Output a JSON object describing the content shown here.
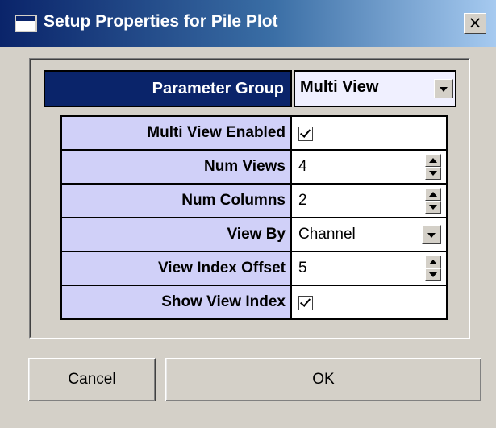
{
  "window": {
    "title": "Setup Properties for Pile Plot",
    "close_label": "×"
  },
  "parameter_group": {
    "label": "Parameter Group",
    "value": "Multi View"
  },
  "properties": [
    {
      "label": "Multi View Enabled",
      "type": "checkbox",
      "checked": true
    },
    {
      "label": "Num Views",
      "type": "spinner",
      "value": "4"
    },
    {
      "label": "Num Columns",
      "type": "spinner",
      "value": "2"
    },
    {
      "label": "View By",
      "type": "dropdown",
      "value": "Channel"
    },
    {
      "label": "View Index Offset",
      "type": "spinner",
      "value": "5"
    },
    {
      "label": "Show View Index",
      "type": "checkbox",
      "checked": true
    }
  ],
  "buttons": {
    "cancel": "Cancel",
    "ok": "OK"
  },
  "colors": {
    "title_bar_start": "#0a246a",
    "title_bar_end": "#a6caf0",
    "label_bg": "#d0d0f8",
    "group_label_bg": "#0a246a",
    "dialog_bg": "#d4d0c8"
  }
}
